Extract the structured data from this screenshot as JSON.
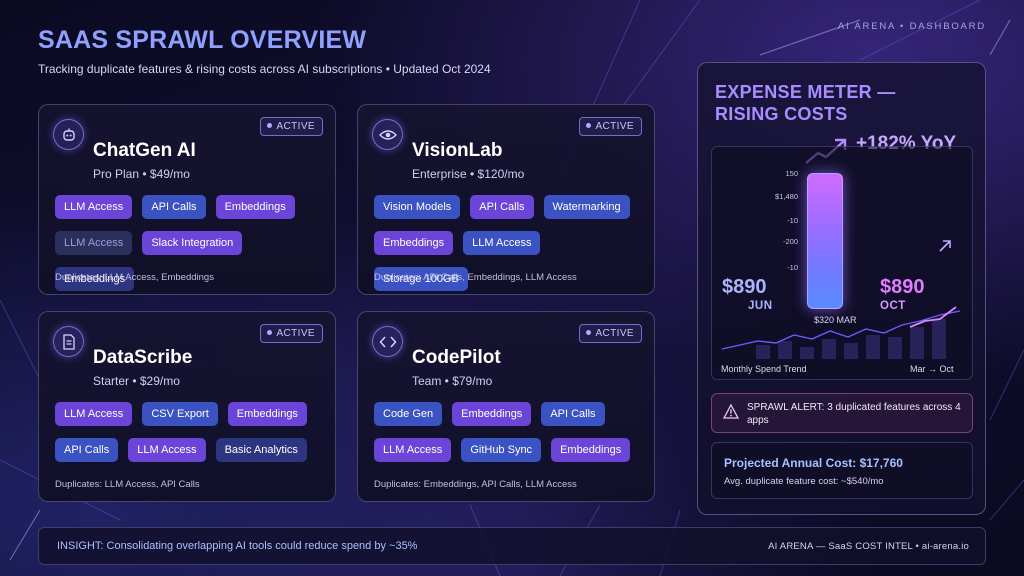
{
  "header": {
    "brand": "AI ARENA  •  DASHBOARD",
    "title": "SAAS SPRAWL OVERVIEW",
    "subtitle": "Tracking duplicate features & rising costs across AI subscriptions  •  Updated Oct 2024"
  },
  "apps": [
    {
      "name": "ChatGen AI",
      "plan": "Pro Plan • $49/mo",
      "status": "ACTIVE",
      "icon": "robot-icon",
      "tags": [
        {
          "label": "LLM Access",
          "style": "purple"
        },
        {
          "label": "API Calls",
          "style": "blue"
        },
        {
          "label": "Embeddings",
          "style": "purple"
        },
        {
          "label": "LLM Access",
          "style": "ghost"
        },
        {
          "label": "Slack Integration",
          "style": "purple"
        },
        {
          "label": "Embeddings",
          "style": "navy"
        }
      ],
      "duplicates": "Duplicates: LLM Access, Embeddings"
    },
    {
      "name": "VisionLab",
      "plan": "Enterprise • $120/mo",
      "status": "ACTIVE",
      "icon": "eye-icon",
      "tags": [
        {
          "label": "Vision Models",
          "style": "blue"
        },
        {
          "label": "API Calls",
          "style": "purple"
        },
        {
          "label": "Watermarking",
          "style": "blue"
        },
        {
          "label": "Embeddings",
          "style": "purple"
        },
        {
          "label": "LLM Access",
          "style": "blue"
        },
        {
          "label": "Storage 100GB",
          "style": "blue"
        }
      ],
      "duplicates": "Duplicates: API Calls, Embeddings, LLM Access"
    },
    {
      "name": "DataScribe",
      "plan": "Starter • $29/mo",
      "status": "ACTIVE",
      "icon": "document-icon",
      "tags": [
        {
          "label": "LLM Access",
          "style": "purple"
        },
        {
          "label": "CSV Export",
          "style": "blue"
        },
        {
          "label": "Embeddings",
          "style": "purple"
        },
        {
          "label": "API Calls",
          "style": "blue"
        },
        {
          "label": "LLM Access",
          "style": "purple"
        },
        {
          "label": "Basic Analytics",
          "style": "navy"
        }
      ],
      "duplicates": "Duplicates: LLM Access, API Calls"
    },
    {
      "name": "CodePilot",
      "plan": "Team • $79/mo",
      "status": "ACTIVE",
      "icon": "code-brackets-icon",
      "tags": [
        {
          "label": "Code Gen",
          "style": "blue"
        },
        {
          "label": "Embeddings",
          "style": "purple"
        },
        {
          "label": "API Calls",
          "style": "blue"
        },
        {
          "label": "LLM Access",
          "style": "purple"
        },
        {
          "label": "GitHub Sync",
          "style": "blue"
        },
        {
          "label": "Embeddings",
          "style": "purple"
        }
      ],
      "duplicates": "Duplicates: Embeddings, API Calls, LLM Access"
    }
  ],
  "meter": {
    "title": "EXPENSE METER — RISING COSTS",
    "yoy": "+182% YoY",
    "axis_labels": [
      "150",
      "$1,480",
      "-10",
      "-200",
      "-10"
    ],
    "left_value": "$890",
    "left_label": "JUN",
    "right_value": "$890",
    "right_label": "OCT",
    "mid_label": "$320 MAR",
    "trend_label": "Monthly Spend Trend",
    "trend_range": "Mar → Oct",
    "alert": "SPRAWL ALERT: 3 duplicated features across 4 apps",
    "projected": "Projected Annual Cost: $17,760",
    "avg_dup": "Avg. duplicate feature cost: ~$540/mo"
  },
  "footer": {
    "insight": "INSIGHT: Consolidating overlapping AI tools could reduce spend by ~35%",
    "brand": "AI ARENA — SaaS COST INTEL  •  ai-arena.io"
  },
  "colors": {
    "accent_purple": "#6b45d8",
    "accent_blue": "#3b52c2",
    "title_blue": "#8fa0ff",
    "meter_title": "#a98cff"
  }
}
